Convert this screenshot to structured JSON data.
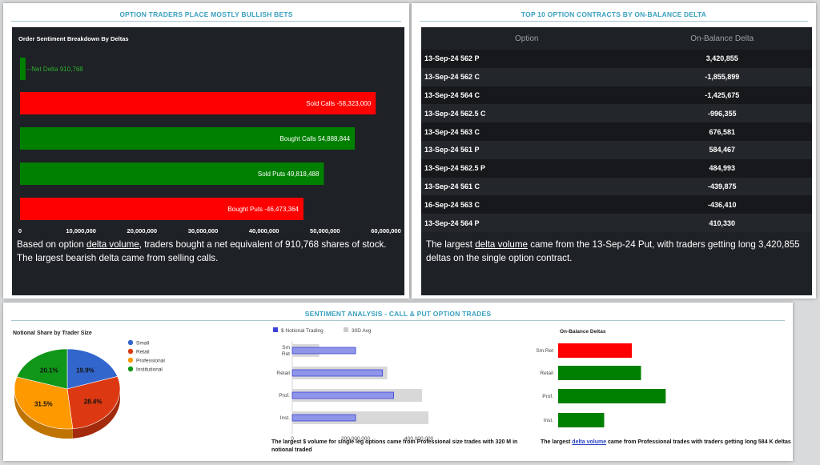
{
  "panels": {
    "sentiment": {
      "title": "OPTION TRADERS PLACE MOSTLY BULLISH BETS",
      "desc_1": "Based on option ",
      "desc_link": "delta volume",
      "desc_2": ", traders bought a net equivalent of 910,768 shares of stock. The largest bearish delta came from selling calls."
    },
    "top10": {
      "title": "TOP 10 OPTION CONTRACTS BY ON-BALANCE DELTA",
      "col_option": "Option",
      "col_delta": "On-Balance Delta",
      "rows": [
        {
          "option": "13-Sep-24 562 P",
          "delta": "3,420,855"
        },
        {
          "option": "13-Sep-24 562 C",
          "delta": "-1,855,899"
        },
        {
          "option": "13-Sep-24 564 C",
          "delta": "-1,425,675"
        },
        {
          "option": "13-Sep-24 562.5 C",
          "delta": "-996,355"
        },
        {
          "option": "13-Sep-24 563 C",
          "delta": "676,581"
        },
        {
          "option": "13-Sep-24 561 P",
          "delta": "584,467"
        },
        {
          "option": "13-Sep-24 562.5 P",
          "delta": "484,993"
        },
        {
          "option": "13-Sep-24 561 C",
          "delta": "-439,875"
        },
        {
          "option": "16-Sep-24 563 C",
          "delta": "-436,410"
        },
        {
          "option": "13-Sep-24 564 P",
          "delta": "410,330"
        }
      ],
      "desc_1": "The largest ",
      "desc_link": "delta volume",
      "desc_2": " came from the 13-Sep-24 Put, with traders getting long 3,420,855 deltas on the single option contract."
    },
    "analysis": {
      "title": "SENTIMENT ANALYSIS - CALL & PUT OPTION TRADES",
      "notional_caption": "The largest $ volume for single leg options came from Professional size trades with 320 M in notional traded",
      "obd_caption_1": "The largest ",
      "obd_caption_link": "delta volume",
      "obd_caption_2": " came from Professional trades with traders getting long 584 K deltas"
    }
  },
  "chart_data": [
    {
      "id": "order-sentiment",
      "type": "bar",
      "orientation": "horizontal",
      "title": "Order Sentiment Breakdown By Deltas",
      "categories": [
        "Net Delta",
        "Sold Calls",
        "Bought Calls",
        "Sold Puts",
        "Bought Puts"
      ],
      "values": [
        910768,
        -58323000,
        54888844,
        49818488,
        -46473364
      ],
      "labels": [
        "Net Delta 910,768",
        "Sold Calls -58,323,000",
        "Bought Calls 54,888,844",
        "Sold Puts 49,818,488",
        "Bought Puts -46,473,364"
      ],
      "colors": [
        "#008000",
        "#ff0000",
        "#008000",
        "#008000",
        "#ff0000"
      ],
      "xlim": [
        0,
        60000000
      ],
      "xticks": [
        "0",
        "10,000,000",
        "20,000,000",
        "30,000,000",
        "40,000,000",
        "50,000,000",
        "60,000,000"
      ],
      "xtick_values": [
        0,
        10000000,
        20000000,
        30000000,
        40000000,
        50000000,
        60000000
      ]
    },
    {
      "id": "notional-share",
      "type": "pie",
      "title": "Notional Share by Trader Size",
      "categories": [
        "Small",
        "Retail",
        "Professional",
        "Institutional"
      ],
      "values": [
        19.9,
        28.4,
        31.5,
        20.1
      ],
      "labels": [
        "19.9%",
        "28.4%",
        "31.5%",
        "20.1%"
      ],
      "colors": [
        "#3366cc",
        "#dc3912",
        "#ff9900",
        "#109618"
      ],
      "side_colors": [
        "#1f4699",
        "#a32a0d",
        "#c07400",
        "#0b6b11"
      ],
      "legend": "right"
    },
    {
      "id": "notional-trading",
      "type": "bar",
      "orientation": "horizontal",
      "categories": [
        "Sm Ret",
        "Retail",
        "Prof.",
        "Inst."
      ],
      "category_lines": [
        [
          "Sm",
          "Ret"
        ],
        [
          "Retail"
        ],
        [
          "Prof."
        ],
        [
          "Inst."
        ]
      ],
      "series": [
        {
          "name": "$ Notional Trading",
          "values": [
            200000000,
            285000000,
            320000000,
            200000000
          ],
          "color": "#8f95e8",
          "border": "#3d44d6"
        },
        {
          "name": "30D Avg",
          "values": [
            85000000,
            300000000,
            410000000,
            430000000
          ],
          "color": "#d8d8d8"
        }
      ],
      "xlim": [
        0,
        440000000
      ],
      "xticks": [
        "0",
        "200,000,000",
        "400,000,000"
      ],
      "xtick_values": [
        0,
        200000000,
        400000000
      ],
      "legend": "top"
    },
    {
      "id": "on-balance-deltas",
      "type": "bar",
      "orientation": "horizontal",
      "title": "On-Balance Deltas",
      "categories": [
        "Sm Ret",
        "Retail",
        "Prof.",
        "Inst."
      ],
      "values": [
        -400000,
        450000,
        584000,
        250000
      ],
      "colors": [
        "#ff0000",
        "#008000",
        "#008000",
        "#008000"
      ],
      "xlim": [
        0,
        600000
      ]
    }
  ]
}
